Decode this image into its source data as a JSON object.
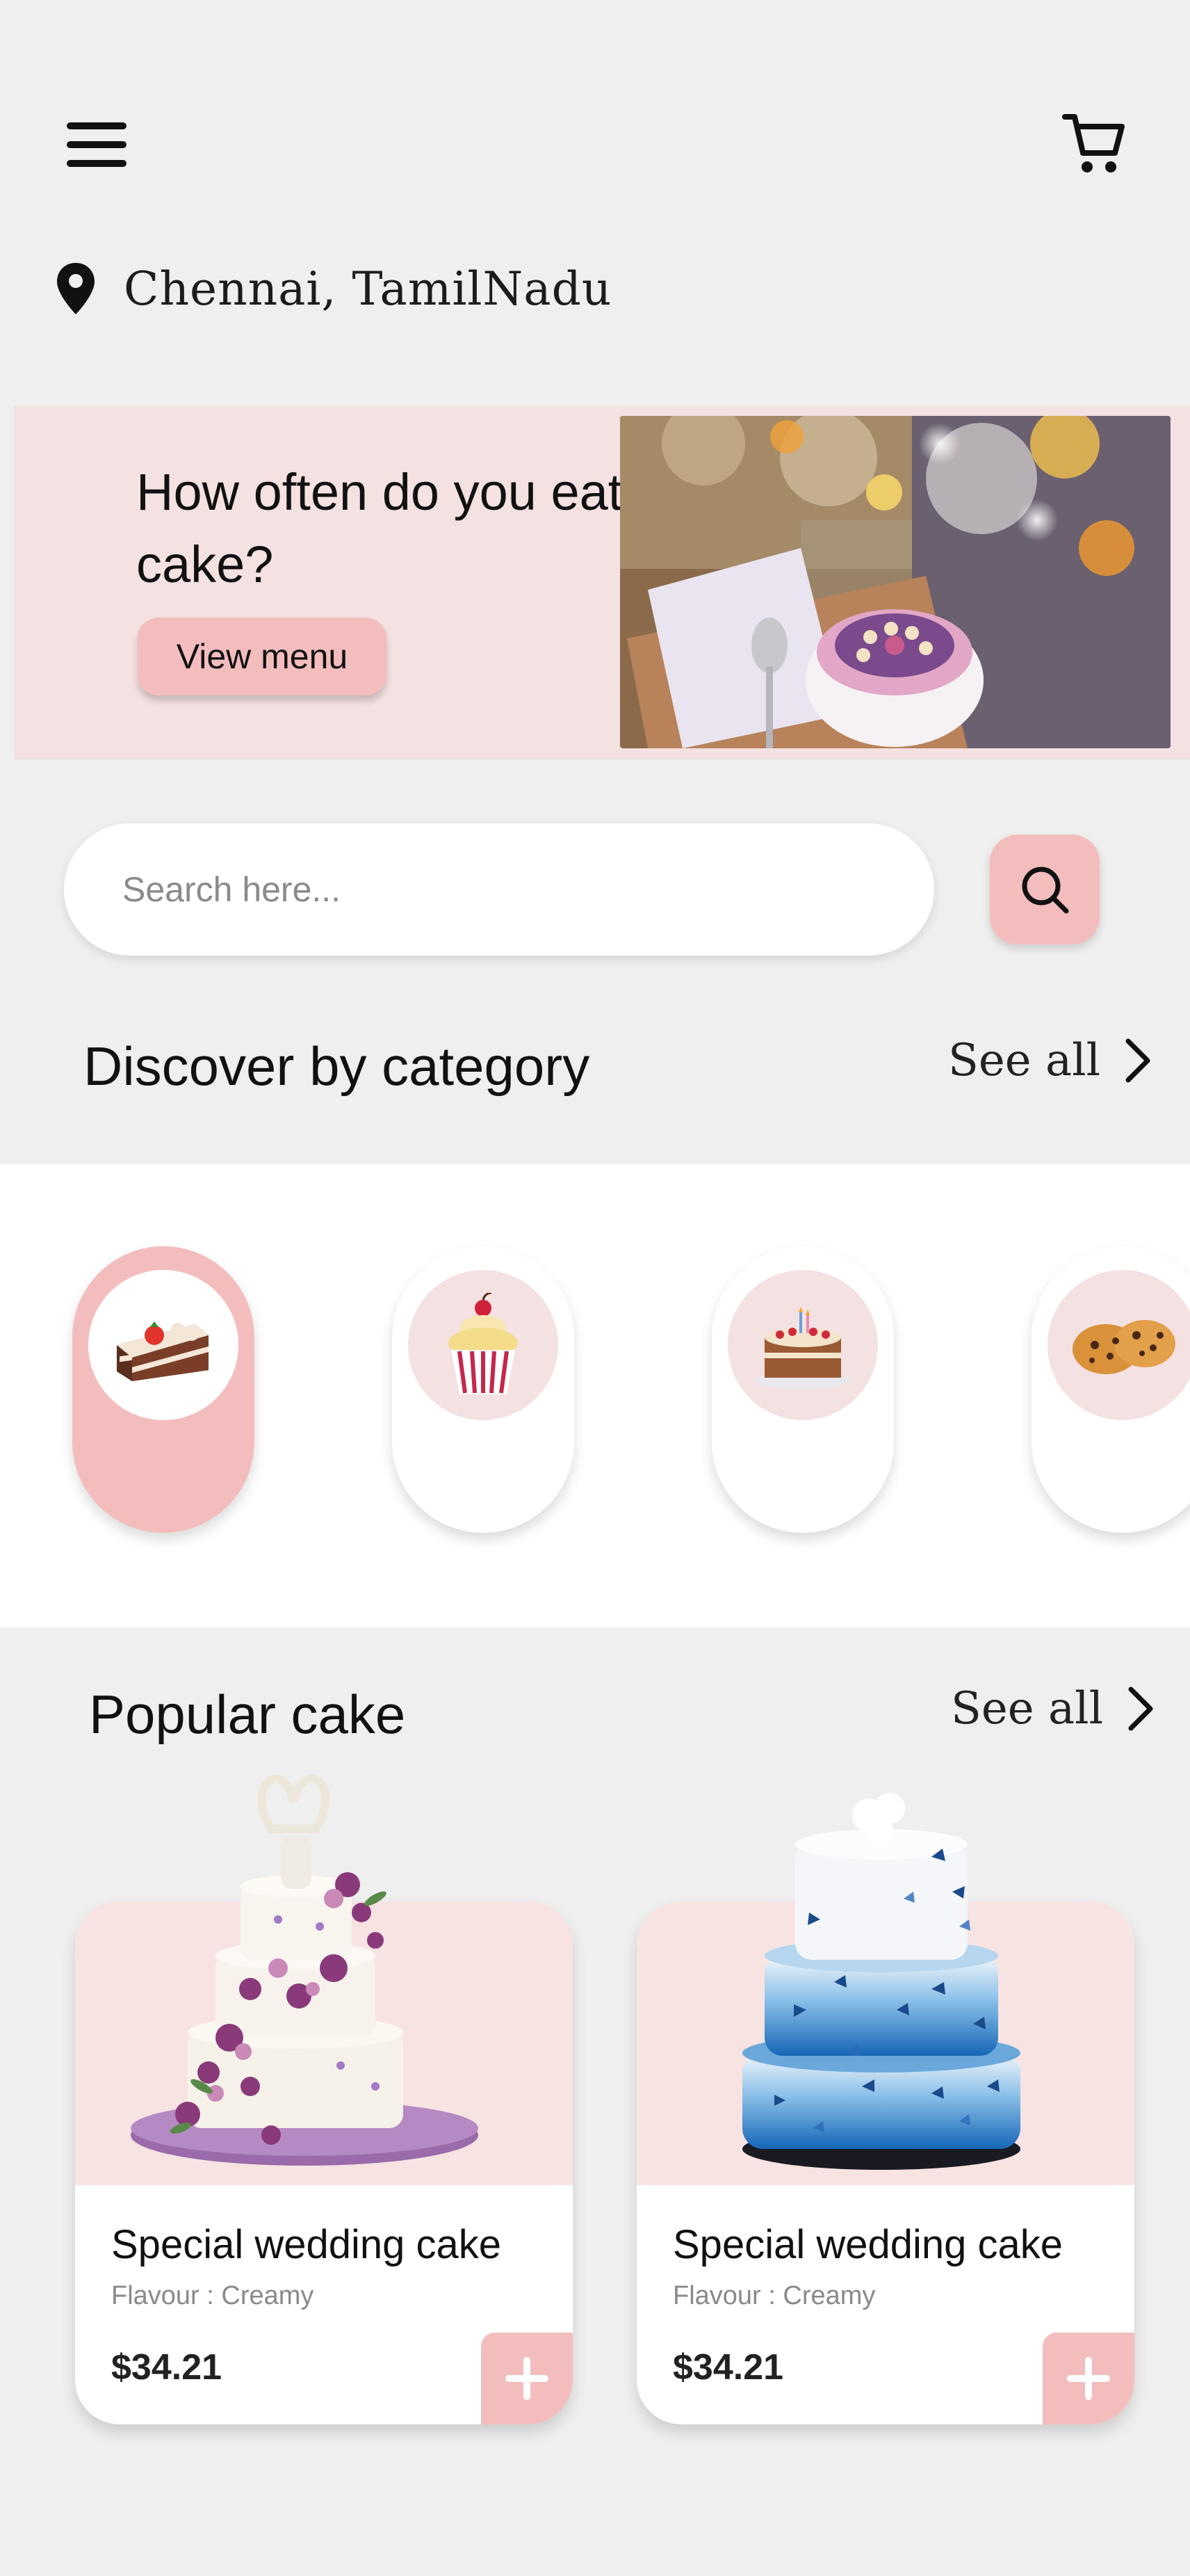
{
  "header": {
    "menu_icon": "hamburger-menu-icon",
    "cart_icon": "shopping-cart-icon",
    "location": "Chennai, TamilNadu",
    "location_icon": "map-pin-icon"
  },
  "promo": {
    "title": "How often do you eat cake?",
    "button_label": "View menu",
    "image": "cupcake-on-table-photo"
  },
  "search": {
    "placeholder": "Search here...",
    "button_icon": "search-icon"
  },
  "categories": {
    "title": "Discover  by category",
    "see_all": "See all",
    "items": [
      {
        "icon": "cake-slice-icon",
        "active": true
      },
      {
        "icon": "cupcake-icon",
        "active": false
      },
      {
        "icon": "birthday-cake-icon",
        "active": false
      },
      {
        "icon": "cookies-icon",
        "active": false
      }
    ]
  },
  "popular": {
    "title": "Popular cake",
    "see_all": "See all",
    "products": [
      {
        "name": "Special wedding cake",
        "flavour": "Flavour : Creamy",
        "price": "$34.21",
        "image": "white-purple-wedding-cake"
      },
      {
        "name": "Special wedding cake",
        "flavour": "Flavour : Creamy",
        "price": "$34.21",
        "image": "blue-butterfly-wedding-cake"
      }
    ]
  },
  "colors": {
    "accent_pink": "#f4bdbd",
    "banner_bg": "#f4e1e2",
    "page_bg": "#efefef"
  }
}
